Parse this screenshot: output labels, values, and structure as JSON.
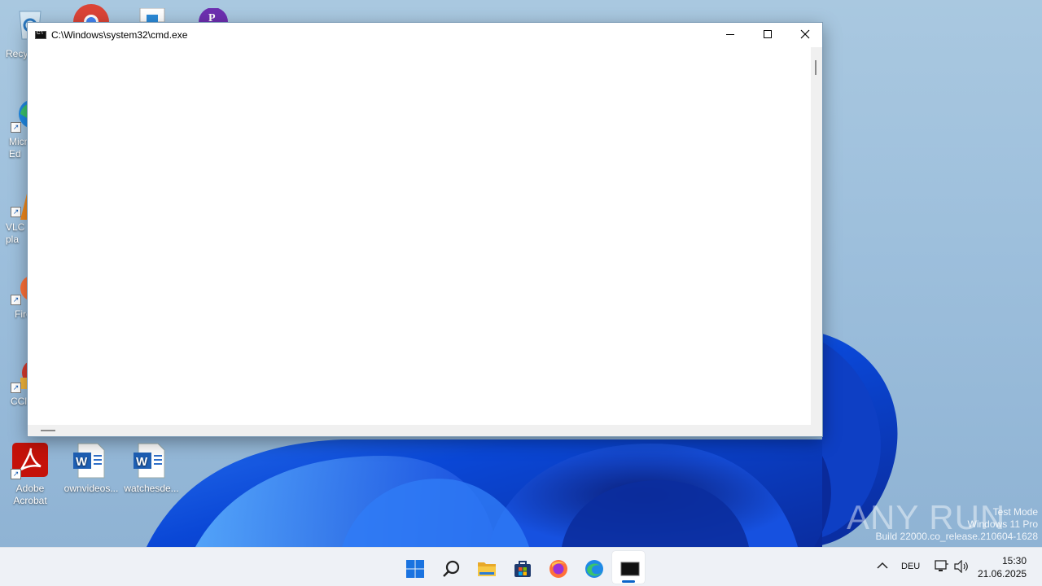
{
  "desktop": {
    "icons": [
      {
        "label": "Recy",
        "glyph": "recycle-bin-icon"
      },
      {
        "label": "Micr\nEd",
        "glyph": "edge-icon"
      },
      {
        "label": "VLC\npla",
        "glyph": "vlc-icon"
      },
      {
        "label": "Fire",
        "glyph": "firefox-icon"
      },
      {
        "label": "CCle",
        "glyph": "ccleaner-icon"
      },
      {
        "label": "Adobe\nAcrobat",
        "glyph": "acrobat-icon"
      },
      {
        "label": "ownvideos...",
        "glyph": "word-document-icon"
      },
      {
        "label": "watchesde...",
        "glyph": "word-document-icon"
      }
    ]
  },
  "window": {
    "title": "C:\\Windows\\system32\\cmd.exe",
    "minimize": "minimize-icon",
    "maximize": "maximize-icon",
    "close": "close-icon"
  },
  "watermark": {
    "brand": "ANY RUN",
    "line1": "Test Mode",
    "line2": "Windows 11 Pro",
    "line3": "Build 22000.co_release.210604-1628"
  },
  "taskbar": {
    "apps": [
      "start-icon",
      "search-icon",
      "file-explorer-icon",
      "store-icon",
      "firefox-icon",
      "edge-icon",
      "cmd-icon"
    ],
    "language": "DEU",
    "time": "15:30",
    "date": "21.06.2025"
  },
  "colors": {
    "accent": "#0a64c9",
    "wallpaper_blue": "#1f5ee8"
  }
}
